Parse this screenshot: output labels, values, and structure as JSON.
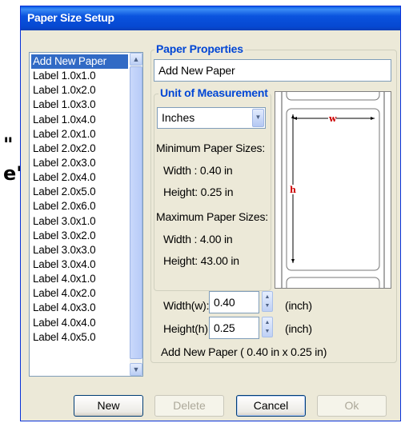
{
  "background_fragments": {
    "frag1": "\"",
    "frag2": "e\"'"
  },
  "window": {
    "title": "Paper Size Setup"
  },
  "paper_list": {
    "selected_index": 0,
    "items": [
      "Add New Paper",
      "Label 1.0x1.0",
      "Label 1.0x2.0",
      "Label 1.0x3.0",
      "Label 1.0x4.0",
      "Label 2.0x1.0",
      "Label 2.0x2.0",
      "Label 2.0x3.0",
      "Label 2.0x4.0",
      "Label 2.0x5.0",
      "Label 2.0x6.0",
      "Label 3.0x1.0",
      "Label 3.0x2.0",
      "Label 3.0x3.0",
      "Label 3.0x4.0",
      "Label 4.0x1.0",
      "Label 4.0x2.0",
      "Label 4.0x3.0",
      "Label 4.0x4.0",
      "Label 4.0x5.0"
    ]
  },
  "paper_properties": {
    "legend": "Paper Properties",
    "name_value": "Add New Paper"
  },
  "unit": {
    "legend": "Unit of Measurement",
    "selected": "Inches",
    "min_title": "Minimum Paper Sizes:",
    "min_width": "Width : 0.40 in",
    "min_height": "Height: 0.25 in",
    "max_title": "Maximum Paper Sizes:",
    "max_width": "Width : 4.00 in",
    "max_height": "Height: 43.00 in"
  },
  "preview": {
    "w_label": "w",
    "h_label": "h",
    "marker_color": "#cc0000"
  },
  "dimensions": {
    "width_label": "Width(w):",
    "width_value": "0.40",
    "width_unit": "(inch)",
    "height_label": "Height(h):",
    "height_value": "0.25",
    "height_unit": "(inch)",
    "summary": "Add New Paper ( 0.40 in x 0.25 in)"
  },
  "buttons": {
    "new": "New",
    "delete": "Delete",
    "cancel": "Cancel",
    "ok": "Ok"
  },
  "colors": {
    "title_bar": "#0a53de",
    "legend": "#0046d5",
    "selection": "#316ac5"
  }
}
